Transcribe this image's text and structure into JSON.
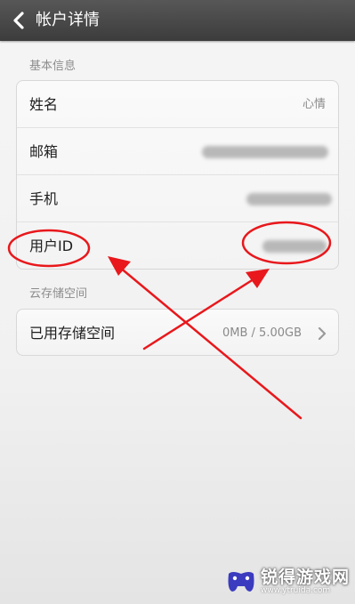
{
  "header": {
    "title": "帐户详情",
    "back_icon": "chevron-left-icon"
  },
  "sections": [
    {
      "label": "基本信息",
      "rows": [
        {
          "label": "姓名",
          "value": "心情"
        },
        {
          "label": "邮箱",
          "value": ""
        },
        {
          "label": "手机",
          "value": ""
        },
        {
          "label": "用户ID",
          "value": ""
        }
      ]
    },
    {
      "label": "云存储空间",
      "rows": [
        {
          "label": "已用存储空间",
          "value": "0MB / 5.00GB"
        }
      ]
    }
  ],
  "annotations": {
    "color": "#e8181c"
  },
  "watermark": {
    "text": "锐得游戏网",
    "url": "www.ytruida.com"
  }
}
